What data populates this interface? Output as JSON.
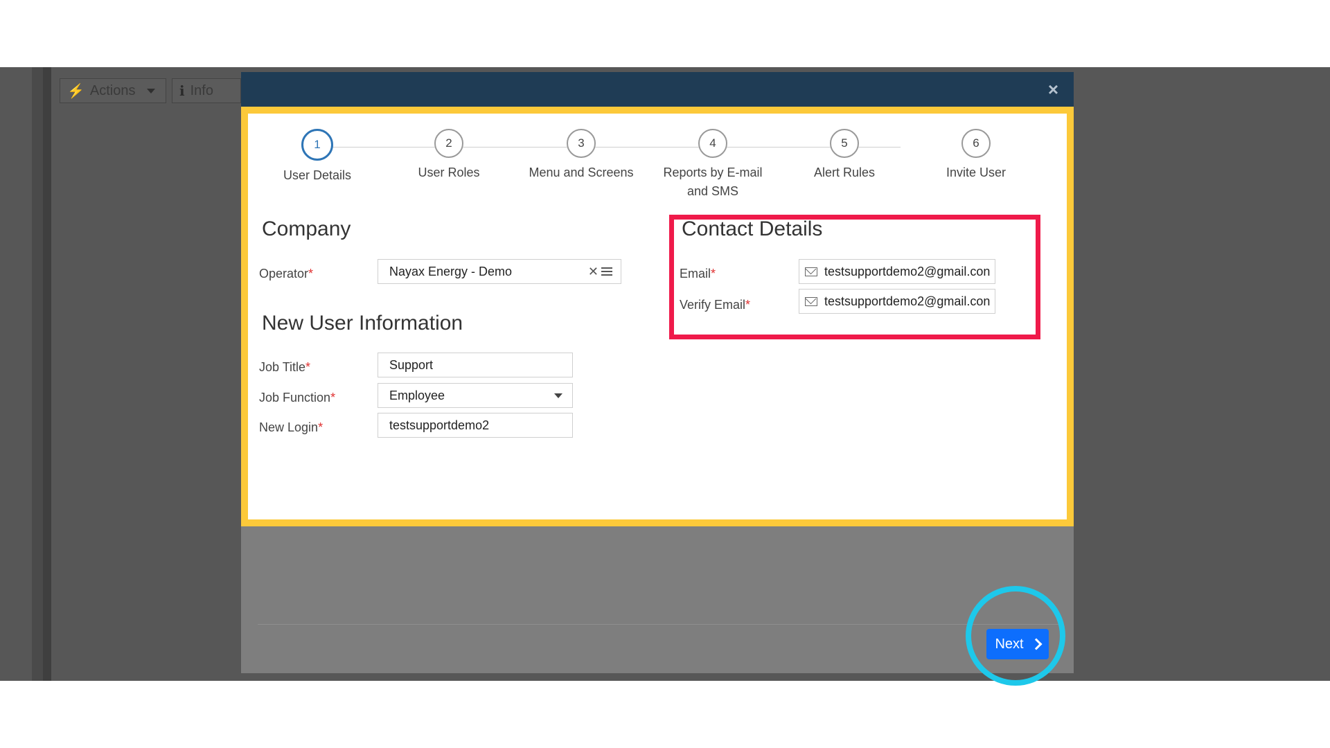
{
  "background_toolbar": {
    "actions_label": "Actions",
    "info_label": "Info"
  },
  "modal": {
    "close_symbol": "×",
    "steps": [
      {
        "number": "1",
        "label": "User Details",
        "active": true
      },
      {
        "number": "2",
        "label": "User Roles",
        "active": false
      },
      {
        "number": "3",
        "label": "Menu and Screens",
        "active": false
      },
      {
        "number": "4",
        "label": "Reports by E-mail and SMS",
        "active": false
      },
      {
        "number": "5",
        "label": "Alert Rules",
        "active": false
      },
      {
        "number": "6",
        "label": "Invite User",
        "active": false
      }
    ],
    "company": {
      "title": "Company",
      "operator_label": "Operator",
      "operator_value": "Nayax Energy - Demo"
    },
    "new_user": {
      "title": "New User Information",
      "job_title_label": "Job Title",
      "job_title_value": "Support",
      "job_function_label": "Job Function",
      "job_function_value": "Employee",
      "new_login_label": "New Login",
      "new_login_value": "testsupportdemo2"
    },
    "contact": {
      "title": "Contact Details",
      "email_label": "Email",
      "email_value": "testsupportdemo2@gmail.con",
      "verify_label": "Verify Email",
      "verify_value": "testsupportdemo2@gmail.con"
    },
    "required_mark": "*",
    "next_label": "Next"
  },
  "colors": {
    "header": "#1f3c55",
    "accent_blue": "#0d6efd",
    "step_active": "#2e75b6",
    "highlight_yellow": "#fcc93a",
    "highlight_red": "#ef1a4a",
    "highlight_cyan": "#1ec8ea"
  },
  "icons": [
    "bolt-icon",
    "caret-down-icon",
    "info-icon",
    "close-icon",
    "clear-icon",
    "list-icon",
    "mail-icon",
    "chevron-right-icon"
  ]
}
